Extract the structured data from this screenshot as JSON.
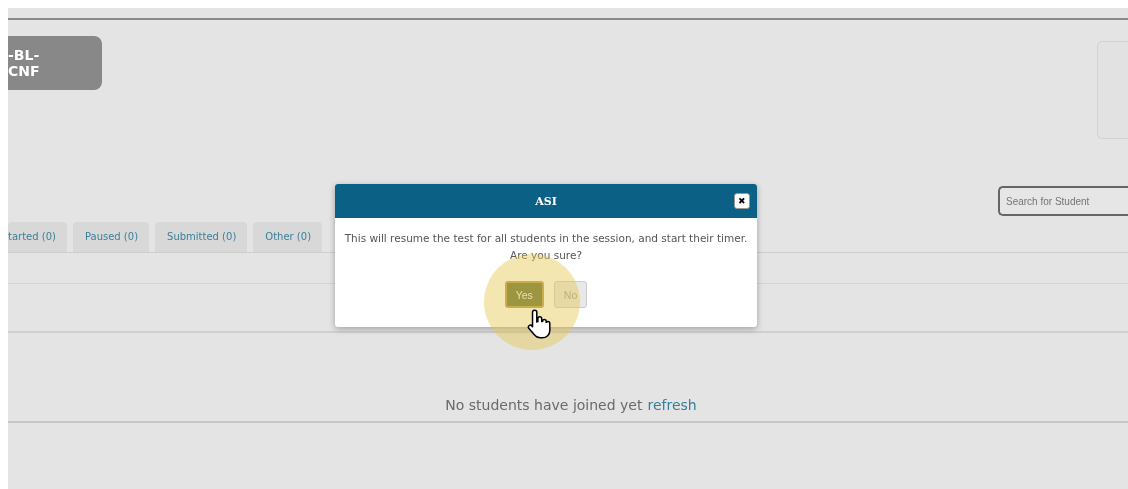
{
  "session_badge": "-BL-CNF",
  "search": {
    "placeholder": "Search for Student"
  },
  "tabs": [
    {
      "label": "tarted (0)",
      "selected": false
    },
    {
      "label": "Paused (0)",
      "selected": false
    },
    {
      "label": "Submitted (0)",
      "selected": false
    },
    {
      "label": "Other (0)",
      "selected": false
    }
  ],
  "empty_message": {
    "text": "No students have joined yet",
    "link": "refresh"
  },
  "dialog": {
    "title": "ASI",
    "close": "✖",
    "message": "This will resume the test for all students in the session, and start their timer. Are you sure?",
    "buttons": [
      {
        "label": "Yes",
        "selected": true
      },
      {
        "label": "No",
        "selected": false
      }
    ]
  }
}
